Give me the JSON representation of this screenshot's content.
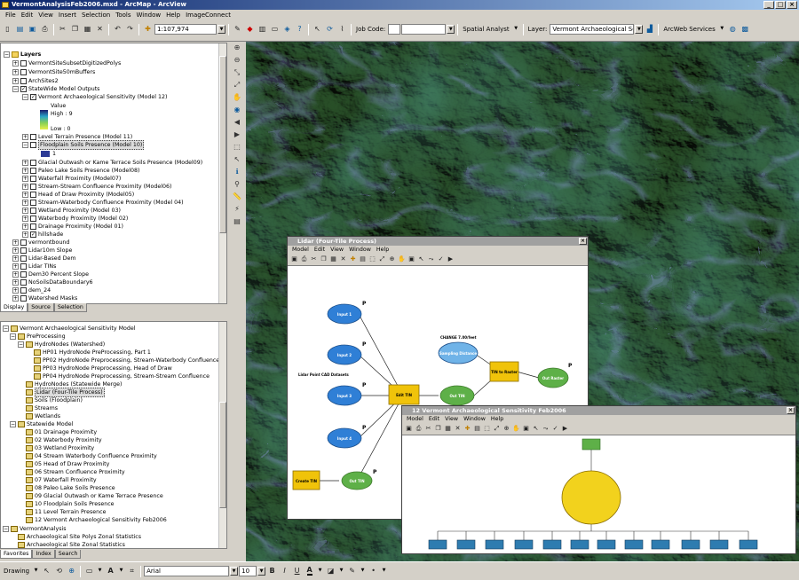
{
  "window": {
    "title": "VermontAnalysisFeb2006.mxd - ArcMap - ArcView",
    "minimize": "_",
    "maximize": "□",
    "close": "×"
  },
  "menu": [
    "File",
    "Edit",
    "View",
    "Insert",
    "Selection",
    "Tools",
    "Window",
    "Help",
    "ImageConnect"
  ],
  "toolbar": {
    "scale": "1:107,974",
    "job_code_label": "Job Code:",
    "spatial_analyst": "Spatial Analyst",
    "layer_label": "Layer:",
    "layer_value": "Vermont Archaeological Sensitivity",
    "arcweb": "ArcWeb Services"
  },
  "toc": {
    "root": "Layers",
    "items": [
      "VermontSiteSubsetDigitizedPolys",
      "VermontSite50mBuffers",
      "ArchSites2",
      "StateWide Model Outputs",
      "Vermont Archaeological Sensitivity (Model 12)",
      "Value",
      "High : 9",
      "Low : 0",
      "Level Terrain Presence (Model 11)",
      "Floodplain Soils Presence (Model 10)",
      "1",
      "Glacial Outwash or Kame Terrace Soils Presence (Model09)",
      "Paleo Lake Soils Presence (Model08)",
      "Waterfall Proximity (Model07)",
      "Stream-Stream Confluence Proximity (Model06)",
      "Head of Draw Proximity (Model05)",
      "Stream-Waterbody Confluence Proximity (Model 04)",
      "Wetland Proximity (Model 03)",
      "Waterbody Proximity (Model 02)",
      "Drainage Proximity (Model 01)",
      "hillshade",
      "vermontbound",
      "Lidar10m Slope",
      "Lidar-Based Dem",
      "Lidar TINs",
      "Dem30 Percent Slope",
      "NoSoilsDataBoundary6",
      "dem_24",
      "Watershed Masks"
    ],
    "tabs": [
      "Display",
      "Source",
      "Selection"
    ]
  },
  "catalog": {
    "items": [
      "Vermont Archaeological Sensitivity Model",
      "PreProcessing",
      "HydroNodes (Watershed)",
      "HP01 HydroNode PreProcessing, Part 1",
      "PP02 HydroNode Preprocessing, Stream-Waterbody Confluence",
      "PP03 HydroNode Preprocessing, Head of Draw",
      "PP04 HydroNode Preprocessing, Stream-Stream Confluence",
      "HydroNodes (Statewide Merge)",
      "Lidar (Four-Tile Process)",
      "Soils (Floodplain)",
      "Streams",
      "Wetlands",
      "Statewide Model",
      "01 Drainage Proximity",
      "02 Waterbody Proximity",
      "03 Wetland Proximity",
      "04 Stream Waterbody Confluence Proximity",
      "05 Head of Draw Proximity",
      "06 Stream Confluence Proximity",
      "07 Waterfall Proximity",
      "08 Paleo Lake Soils Presence",
      "09 Glacial Outwash or Kame Terrace Presence",
      "10 Floodplain Soils Presence",
      "11 Level Terrain Presence",
      "12 Vermont Archaeological Sensitivity Feb2006",
      "VermontAnalysis",
      "Archaeological Site Polys Zonal Statistics",
      "Archaeological Site Zonal Statistics"
    ],
    "tabs": [
      "Favorites",
      "Index",
      "Search"
    ]
  },
  "lidar_window": {
    "title": "Lidar (Four-Tile Process)",
    "menu": [
      "Model",
      "Edit",
      "View",
      "Window",
      "Help"
    ],
    "nodes": {
      "in1": "Input 1",
      "in2": "Input 2",
      "in3": "Input 3",
      "in4": "Input 4",
      "edit": "Edit TIN",
      "create": "Create TIN",
      "outtin": "Out TIN",
      "outtin2": "Out TIN",
      "sampling": "Sampling Distance",
      "raster": "TIN to Raster",
      "out": "Out Raster",
      "p": "P",
      "note1": "Lidar Point CAD Datasets",
      "note2": "CHANGE 7.00/feet"
    }
  },
  "vt_window": {
    "title": "12 Vermont Archaeological Sensitivity Feb2006",
    "menu": [
      "Model",
      "Edit",
      "View",
      "Window",
      "Help"
    ]
  },
  "statusbar": {
    "drawing": "Drawing",
    "font": "Arial",
    "size": "10",
    "bold": "B",
    "italic": "I",
    "underline": "U"
  },
  "colors": {
    "titlebar_start": "#0a246a",
    "titlebar_end": "#a6caf0",
    "ellipse_blue": "#2f7fd6",
    "ellipse_green": "#5eb048",
    "tool_yellow": "#f0c30a",
    "vt_box": "#2e7cb0",
    "vt_circle": "#f2d21d"
  }
}
